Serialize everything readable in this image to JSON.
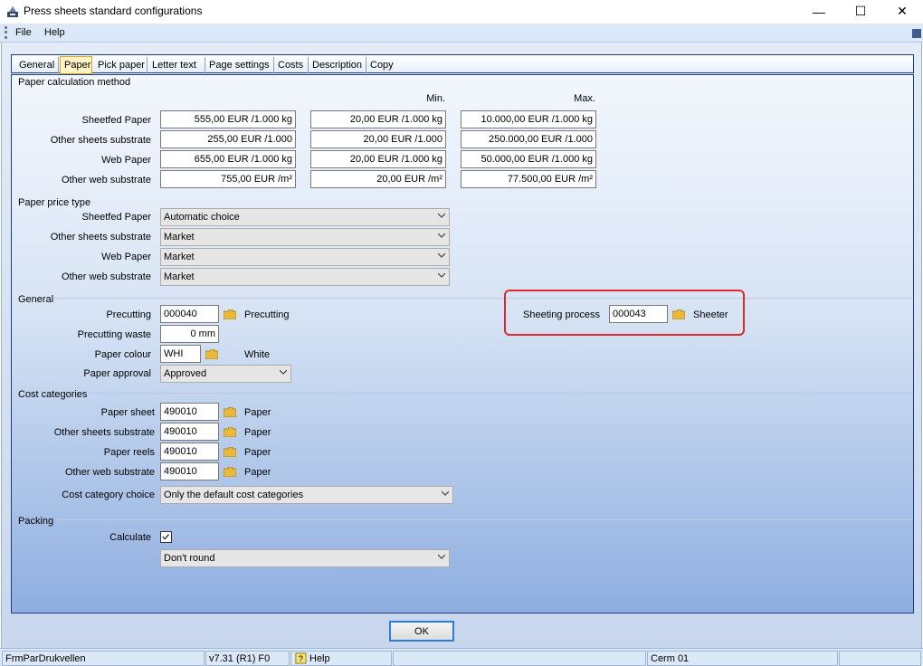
{
  "window": {
    "title": "Press sheets standard configurations",
    "minimize": "—",
    "maximize": "☐",
    "close": "✕"
  },
  "menu": {
    "file": "File",
    "help": "Help"
  },
  "tabs": [
    {
      "label": "General"
    },
    {
      "label": "Paper"
    },
    {
      "label": "Pick paper"
    },
    {
      "label": "Letter text"
    },
    {
      "label": "Page settings"
    },
    {
      "label": "Costs"
    },
    {
      "label": "Description"
    },
    {
      "label": "Copy"
    }
  ],
  "active_tab": "Paper",
  "calc": {
    "section": "Paper calculation method",
    "min_header": "Min.",
    "max_header": "Max.",
    "rows": [
      {
        "label": "Sheetfed Paper",
        "value": "555,00 EUR /1.000 kg",
        "min": "20,00 EUR /1.000 kg",
        "max": "10.000,00 EUR /1.000 kg"
      },
      {
        "label": "Other sheets substrate",
        "value": "255,00 EUR /1.000",
        "min": "20,00 EUR /1.000",
        "max": "250.000,00 EUR /1.000"
      },
      {
        "label": "Web Paper",
        "value": "655,00 EUR /1.000 kg",
        "min": "20,00 EUR /1.000 kg",
        "max": "50.000,00 EUR /1.000 kg"
      },
      {
        "label": "Other web substrate",
        "value": "755,00 EUR /m²",
        "min": "20,00 EUR /m²",
        "max": "77.500,00 EUR /m²"
      }
    ]
  },
  "price_type": {
    "section": "Paper price type",
    "rows": [
      {
        "label": "Sheetfed Paper",
        "value": "Automatic choice"
      },
      {
        "label": "Other sheets substrate",
        "value": "Market"
      },
      {
        "label": "Web Paper",
        "value": "Market"
      },
      {
        "label": "Other web substrate",
        "value": "Market"
      }
    ]
  },
  "general": {
    "section": "General",
    "precutting_label": "Precutting",
    "precutting_value": "000040",
    "precutting_desc": "Precutting",
    "waste_label": "Precutting waste",
    "waste_value": "0 mm",
    "colour_label": "Paper colour",
    "colour_value": "WHI",
    "colour_desc": "White",
    "approval_label": "Paper approval",
    "approval_value": "Approved",
    "sheeting_label": "Sheeting process",
    "sheeting_value": "000043",
    "sheeting_desc": "Sheeter"
  },
  "cost": {
    "section": "Cost categories",
    "rows": [
      {
        "label": "Paper sheet",
        "value": "490010",
        "desc": "Paper"
      },
      {
        "label": "Other sheets substrate",
        "value": "490010",
        "desc": "Paper"
      },
      {
        "label": "Paper reels",
        "value": "490010",
        "desc": "Paper"
      },
      {
        "label": "Other web substrate",
        "value": "490010",
        "desc": "Paper"
      }
    ],
    "choice_label": "Cost category choice",
    "choice_value": "Only the default cost categories"
  },
  "packing": {
    "section": "Packing",
    "calculate_label": "Calculate",
    "calculate_checked": true,
    "rounding_value": "Don't round"
  },
  "ok_label": "OK",
  "status": {
    "form": "FrmParDrukvellen",
    "version": "v7.31 (R1) F0",
    "help": "Help",
    "user": "Cerm 01"
  },
  "colors": {
    "highlight": "#e0282a",
    "active_tab": "#fff4c8",
    "frame_border": "#1f3e84"
  }
}
